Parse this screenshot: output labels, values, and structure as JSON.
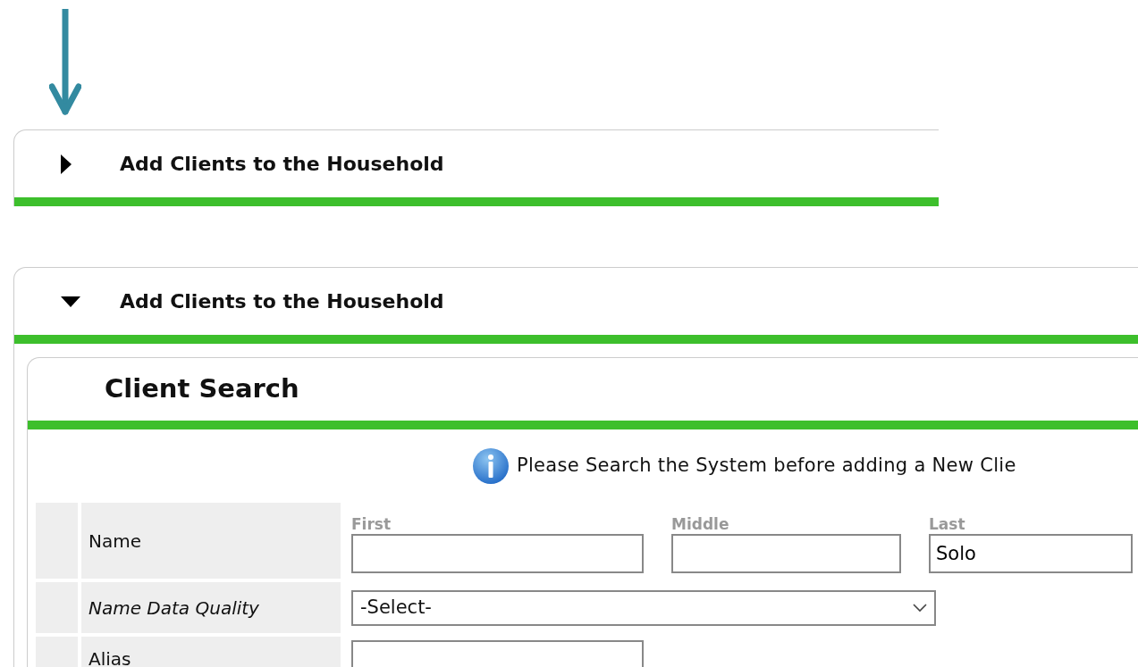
{
  "panels": [
    {
      "title": "Add Clients to the Household",
      "expanded": false
    },
    {
      "title": "Add Clients to the Household",
      "expanded": true
    }
  ],
  "client_search": {
    "title": "Client Search",
    "notice": "Please Search the System before adding a New Clie",
    "rows": [
      {
        "label": "Name",
        "italic": false,
        "kind": "name",
        "fields": [
          {
            "caption": "First"
          },
          {
            "caption": "Middle"
          },
          {
            "caption": "Last",
            "value": "Solo"
          }
        ]
      },
      {
        "label": "Name Data Quality",
        "italic": true,
        "kind": "select",
        "value": "-Select-"
      },
      {
        "label": "Alias",
        "italic": false,
        "kind": "text"
      }
    ]
  }
}
